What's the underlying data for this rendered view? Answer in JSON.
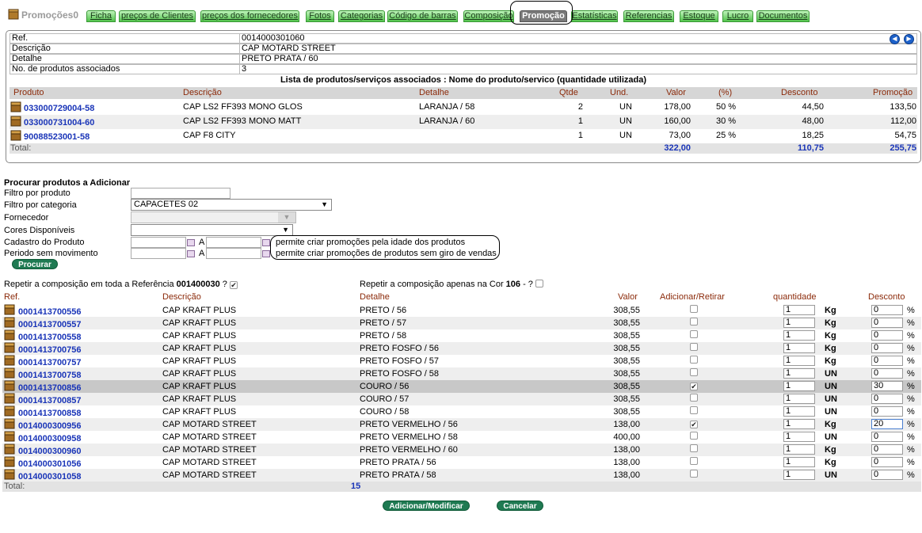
{
  "app": {
    "title": "Promoções0"
  },
  "tabs": [
    "Ficha",
    "preços de Clientes",
    "preços dos fornecedores",
    "Fotos",
    "Categorias",
    "Código de barras",
    "Composição",
    "Promoção",
    "Estatísticas",
    "Referencias",
    "Estoque",
    "Lucro",
    "Documentos"
  ],
  "active_tab": "Promoção",
  "info": {
    "ref_label": "Ref.",
    "ref": "0014000301060",
    "descricao_label": "Descrição",
    "descricao": "CAP MOTARD STREET",
    "detalhe_label": "Detalhe",
    "detalhe": "PRETO PRATA / 60",
    "count_label": "No. de produtos associados",
    "count": "3",
    "nav_prev": "◄",
    "nav_next": "►"
  },
  "assoc": {
    "title": "Lista de produtos/serviços associados : Nome do produto/servico (quantidade utilizada)",
    "headers": {
      "produto": "Produto",
      "descricao": "Descrição",
      "detalhe": "Detalhe",
      "qtde": "Qtde",
      "und": "Und.",
      "valor": "Valor",
      "pct": "(%)",
      "desconto": "Desconto",
      "promocao": "Promoção"
    },
    "rows": [
      {
        "produto": "033000729004-58",
        "descricao": "CAP LS2 FF393 MONO GLOS",
        "detalhe": "LARANJA / 58",
        "qtde": "2",
        "und": "UN",
        "valor": "178,00",
        "pct": "50 %",
        "desconto": "44,50",
        "promocao": "133,50"
      },
      {
        "produto": "033000731004-60",
        "descricao": "CAP LS2 FF393 MONO MATT",
        "detalhe": "LARANJA / 60",
        "qtde": "1",
        "und": "UN",
        "valor": "160,00",
        "pct": "30 %",
        "desconto": "48,00",
        "promocao": "112,00"
      },
      {
        "produto": "90088523001-58",
        "descricao": "CAP F8 CITY",
        "detalhe": "",
        "qtde": "1",
        "und": "UN",
        "valor": "73,00",
        "pct": "25 %",
        "desconto": "18,25",
        "promocao": "54,75"
      }
    ],
    "total_label": "Total:",
    "total_valor": "322,00",
    "total_desconto": "110,75",
    "total_promocao": "255,75"
  },
  "search": {
    "title": "Procurar produtos a Adicionar",
    "filtro_produto_label": "Filtro por produto",
    "filtro_produto_value": "",
    "filtro_categoria_label": "Filtro por categoria",
    "filtro_categoria_value": "CAPACETES 02",
    "fornecedor_label": "Fornecedor",
    "fornecedor_value": "",
    "cores_label": "Cores Disponíveis",
    "cores_value": "",
    "cadastro_label": "Cadastro do Produto",
    "periodo_label": "Periodo sem movimento",
    "a_label": "A",
    "cadastro_hint": "permite criar promoções pela idade dos produtos",
    "periodo_hint": "permite criar promoções de produtos sem giro de vendas",
    "procurar_label": "Procurar"
  },
  "repeat": {
    "ref_text_pre": "Repetir a composição em toda a Referência ",
    "ref_code": "001400030",
    "ref_text_post": " ?",
    "cor_text_pre": "Repetir a composição apenas na Cor ",
    "cor_code": "106",
    "cor_text_post": " - ?"
  },
  "results": {
    "headers": {
      "ref": "Ref.",
      "descricao": "Descrição",
      "detalhe": "Detalhe",
      "valor": "Valor",
      "adicionar": "Adicionar/Retirar",
      "quantidade": "quantidade",
      "desconto": "Desconto"
    },
    "rows": [
      {
        "ref": "0001413700556",
        "descricao": "CAP KRAFT PLUS",
        "detalhe": "PRETO / 56",
        "valor": "308,55",
        "checked": false,
        "qtd": "1",
        "unit": "Kg",
        "desc": "0"
      },
      {
        "ref": "0001413700557",
        "descricao": "CAP KRAFT PLUS",
        "detalhe": "PRETO / 57",
        "valor": "308,55",
        "checked": false,
        "qtd": "1",
        "unit": "Kg",
        "desc": "0"
      },
      {
        "ref": "0001413700558",
        "descricao": "CAP KRAFT PLUS",
        "detalhe": "PRETO / 58",
        "valor": "308,55",
        "checked": false,
        "qtd": "1",
        "unit": "Kg",
        "desc": "0"
      },
      {
        "ref": "0001413700756",
        "descricao": "CAP KRAFT PLUS",
        "detalhe": "PRETO FOSFO / 56",
        "valor": "308,55",
        "checked": false,
        "qtd": "1",
        "unit": "Kg",
        "desc": "0"
      },
      {
        "ref": "0001413700757",
        "descricao": "CAP KRAFT PLUS",
        "detalhe": "PRETO FOSFO / 57",
        "valor": "308,55",
        "checked": false,
        "qtd": "1",
        "unit": "Kg",
        "desc": "0"
      },
      {
        "ref": "0001413700758",
        "descricao": "CAP KRAFT PLUS",
        "detalhe": "PRETO FOSFO / 58",
        "valor": "308,55",
        "checked": false,
        "qtd": "1",
        "unit": "UN",
        "desc": "0"
      },
      {
        "ref": "0001413700856",
        "descricao": "CAP KRAFT PLUS",
        "detalhe": "COURO / 56",
        "valor": "308,55",
        "checked": true,
        "qtd": "1",
        "unit": "UN",
        "desc": "30"
      },
      {
        "ref": "0001413700857",
        "descricao": "CAP KRAFT PLUS",
        "detalhe": "COURO / 57",
        "valor": "308,55",
        "checked": false,
        "qtd": "1",
        "unit": "UN",
        "desc": "0"
      },
      {
        "ref": "0001413700858",
        "descricao": "CAP KRAFT PLUS",
        "detalhe": "COURO / 58",
        "valor": "308,55",
        "checked": false,
        "qtd": "1",
        "unit": "UN",
        "desc": "0"
      },
      {
        "ref": "0014000300956",
        "descricao": "CAP MOTARD STREET",
        "detalhe": "PRETO VERMELHO / 56",
        "valor": "138,00",
        "checked": true,
        "qtd": "1",
        "unit": "Kg",
        "desc": "20"
      },
      {
        "ref": "0014000300958",
        "descricao": "CAP MOTARD STREET",
        "detalhe": "PRETO VERMELHO / 58",
        "valor": "400,00",
        "checked": false,
        "qtd": "1",
        "unit": "UN",
        "desc": "0"
      },
      {
        "ref": "0014000300960",
        "descricao": "CAP MOTARD STREET",
        "detalhe": "PRETO VERMELHO / 60",
        "valor": "138,00",
        "checked": false,
        "qtd": "1",
        "unit": "Kg",
        "desc": "0"
      },
      {
        "ref": "0014000301056",
        "descricao": "CAP MOTARD STREET",
        "detalhe": "PRETO PRATA / 56",
        "valor": "138,00",
        "checked": false,
        "qtd": "1",
        "unit": "Kg",
        "desc": "0"
      },
      {
        "ref": "0014000301058",
        "descricao": "CAP MOTARD STREET",
        "detalhe": "PRETO PRATA / 58",
        "valor": "138,00",
        "checked": false,
        "qtd": "1",
        "unit": "UN",
        "desc": "0"
      }
    ],
    "pct": "%",
    "total_label": "Total:",
    "total_count": "15"
  },
  "actions": {
    "adicionar": "Adicionar/Modificar",
    "cancelar": "Cancelar"
  }
}
